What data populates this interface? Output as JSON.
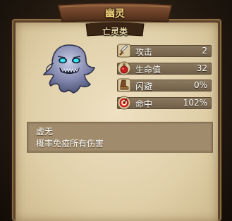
{
  "card": {
    "name": "幽灵",
    "category": "亡灵类",
    "portrait_icon": "ghost-icon"
  },
  "stats": [
    {
      "icon": "sword-icon",
      "label": "攻击",
      "value": "2"
    },
    {
      "icon": "potion-icon",
      "label": "生命值",
      "value": "32"
    },
    {
      "icon": "boot-icon",
      "label": "闪避",
      "value": "0%"
    },
    {
      "icon": "target-icon",
      "label": "命中",
      "value": "102%"
    }
  ],
  "ability": {
    "name": "虚无",
    "description": "概率免疫所有伤害"
  },
  "colors": {
    "title": "#f3d27a",
    "parchment": "#e6d6b2",
    "stat_bar": "#7d6c53"
  }
}
